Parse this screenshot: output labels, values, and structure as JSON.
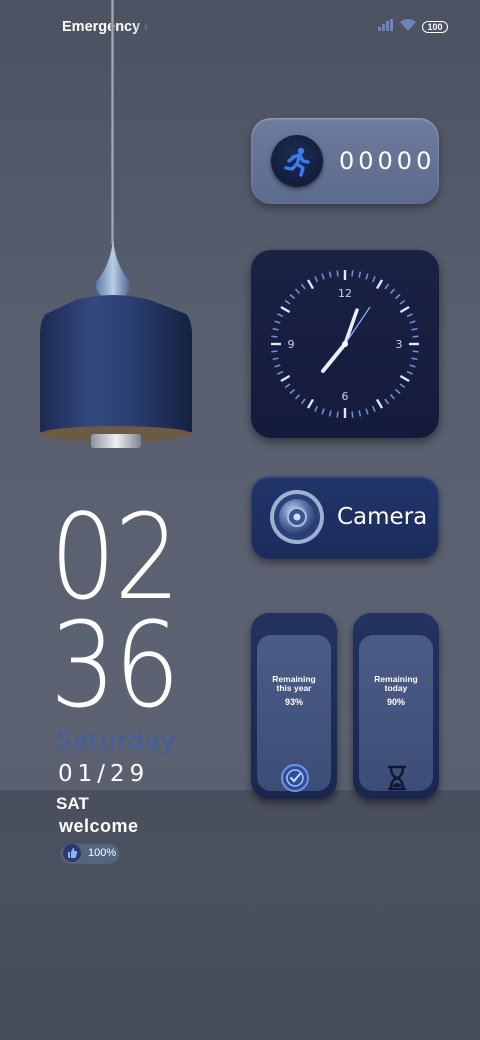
{
  "status_bar": {
    "carrier": "Emergency c",
    "battery": "100",
    "icons": [
      "signal-icon",
      "wifi-icon",
      "battery-icon"
    ]
  },
  "steps_widget": {
    "count": "00000",
    "icon": "running-person-icon"
  },
  "clock_widget": {
    "numerals": [
      "12",
      "3",
      "6",
      "9"
    ]
  },
  "camera_widget": {
    "label": "Camera",
    "icon": "camera-lens-icon"
  },
  "remaining_year": {
    "title_line1": "Remaining",
    "title_line2": "this year",
    "percent": "93%",
    "icon": "clock-check-icon"
  },
  "remaining_today": {
    "title_line1": "Remaining",
    "title_line2": "today",
    "percent": "90%",
    "icon": "hourglass-icon"
  },
  "time": {
    "hours": "02",
    "minutes": "36"
  },
  "date": {
    "day_name": "Saturday",
    "date": "01/29",
    "day_short": "SAT"
  },
  "greeting": "welcome",
  "battery_pill": {
    "text": "100%",
    "icon": "thumb-icon"
  },
  "colors": {
    "accent_blue": "#3f5ea3",
    "widget_dark": "#141b3a",
    "widget_blue": "#1b2c5b"
  }
}
